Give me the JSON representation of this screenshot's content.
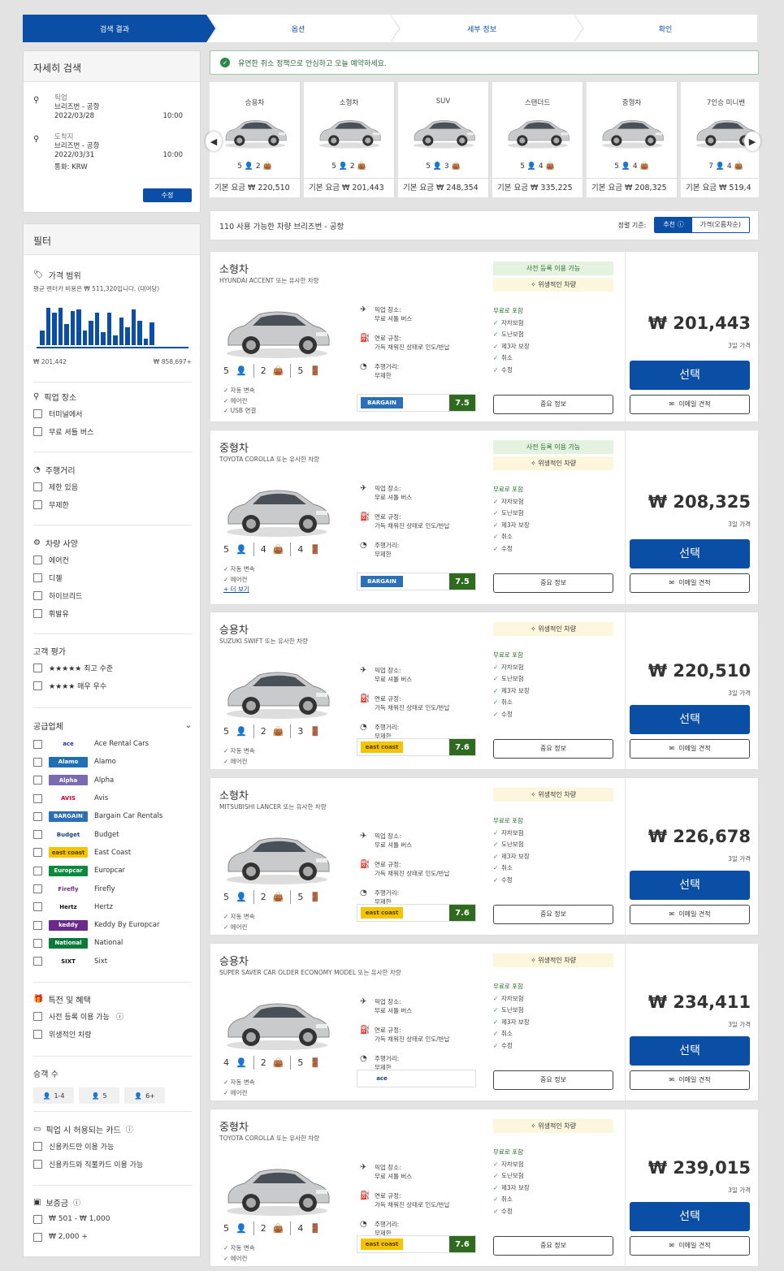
{
  "steps": [
    "검색 결과",
    "옵션",
    "세부 정보",
    "확인"
  ],
  "search": {
    "title": "자세히 검색",
    "pickup_label": "픽업",
    "pickup_place": "브리즈번 - 공항",
    "pickup_date": "2022/03/28",
    "pickup_time": "10:00",
    "drop_label": "도착지",
    "drop_place": "브리즈번 - 공항",
    "drop_date": "2022/03/31",
    "drop_time": "10:00",
    "currency": "통화: KRW",
    "edit": "수정"
  },
  "notice": "유연한 취소 정책으로 안심하고 오늘 예약하세요.",
  "categories": [
    {
      "name": "승용차",
      "spec": "5 👤 2 👜",
      "price": "기본 요금 ₩ 220,510"
    },
    {
      "name": "소형차",
      "spec": "5 👤 2 👜",
      "price": "기본 요금 ₩ 201,443"
    },
    {
      "name": "SUV",
      "spec": "5 👤 3 👜",
      "price": "기본 요금 ₩ 248,354"
    },
    {
      "name": "스탠더드",
      "spec": "5 👤 4 👜",
      "price": "기본 요금 ₩ 335,225"
    },
    {
      "name": "중형차",
      "spec": "5 👤 4 👜",
      "price": "기본 요금 ₩ 208,325"
    },
    {
      "name": "7인승 미니밴",
      "spec": "7 👤 4 👜",
      "price": "기본 요금 ₩ 519,4"
    }
  ],
  "results": {
    "text": "110 사용 가능한 차량 브리즈번 - 공항",
    "sort_label": "정렬 기준:",
    "sort_rec": "추천",
    "sort_price": "가격(오름차순)"
  },
  "filters": {
    "title": "필터",
    "price_title": "가격 범위",
    "price_avg": "평균 렌터카 비용은 ₩ 511,320입니다. (대여당)",
    "price_min": "₩ 201,442",
    "price_max": "₩ 858,697+",
    "pickup_title": "픽업 장소",
    "pickup_opts": [
      "터미널에서",
      "무료 셔틀 버스"
    ],
    "mileage_title": "주행거리",
    "mileage_opts": [
      "제한 있음",
      "무제한"
    ],
    "spec_title": "차량 사양",
    "spec_opts": [
      "에어컨",
      "디젤",
      "하이브리드",
      "휘발유"
    ],
    "rating_title": "고객 평가",
    "rating_opts": [
      "★★★★★ 최고 수준",
      "★★★★ 매우 우수"
    ],
    "supplier_title": "공급업체",
    "suppliers": [
      {
        "logo": "ace",
        "name": "Ace Rental Cars",
        "bg": "#ffffff",
        "fg": "#1f3c8c"
      },
      {
        "logo": "Alamo",
        "name": "Alamo",
        "bg": "#1f6fb5",
        "fg": "#ffffff"
      },
      {
        "logo": "Alpha",
        "name": "Alpha",
        "bg": "#7a6bb0",
        "fg": "#ffffff"
      },
      {
        "logo": "AVIS",
        "name": "Avis",
        "bg": "#ffffff",
        "fg": "#d4002a"
      },
      {
        "logo": "BARGAIN",
        "name": "Bargain Car Rentals",
        "bg": "#2b6fb8",
        "fg": "#ffffff"
      },
      {
        "logo": "Budget",
        "name": "Budget",
        "bg": "#ffffff",
        "fg": "#1c3f8f"
      },
      {
        "logo": "east coast",
        "name": "East Coast",
        "bg": "#f3c400",
        "fg": "#5a3b00"
      },
      {
        "logo": "Europcar",
        "name": "Europcar",
        "bg": "#0a8a3c",
        "fg": "#ffffff"
      },
      {
        "logo": "Firefly",
        "name": "Firefly",
        "bg": "#ffffff",
        "fg": "#7a2a8a"
      },
      {
        "logo": "Hertz",
        "name": "Hertz",
        "bg": "#ffffff",
        "fg": "#111111"
      },
      {
        "logo": "keddy",
        "name": "Keddy By Europcar",
        "bg": "#6a2a8c",
        "fg": "#ffffff"
      },
      {
        "logo": "National",
        "name": "National",
        "bg": "#0a7a3a",
        "fg": "#ffffff"
      },
      {
        "logo": "SIXT",
        "name": "Sixt",
        "bg": "#ffffff",
        "fg": "#111111"
      }
    ],
    "deals_title": "특전 및 혜택",
    "deals_opts": [
      "사전 등록 이용 가능",
      "위생적인 차량"
    ],
    "pax_title": "승객 수",
    "pax_opts": [
      "1-4",
      "5",
      "6+"
    ],
    "card_title": "픽업 시 허용되는 카드",
    "card_opts": [
      "신용카드만 이용 가능",
      "신용카드와 직불카드 이용 가능"
    ],
    "deposit_title": "보증금",
    "deposit_opts": [
      "₩ 501 - ₩ 1,000",
      "₩ 2,000 +"
    ]
  },
  "labels": {
    "pickup": "픽업 장소:",
    "pickup_val": "무료 셔틀 버스",
    "fuel": "연료 규정:",
    "fuel_val": "가득 채워진 상태로 인도/반납",
    "mileage": "주행거리:",
    "mileage_val": "무제한",
    "included": "무료로 포함",
    "inc_items": [
      "자차보험",
      "도난보험",
      "제3자 보장",
      "취소",
      "수정"
    ],
    "important": "중요 정보",
    "select": "선택",
    "email": "이메일 견적",
    "days": "3일 가격",
    "prereg": "사전 등록 이용 가능",
    "hygiene": "위생적인 차량",
    "more": "+ 더 보기"
  },
  "cars": [
    {
      "cls": "소형차",
      "model": "HYUNDAI ACCENT 또는 유사한 차량",
      "pax": "5",
      "bags": "2",
      "doors": "5",
      "feats": [
        "자동 변속",
        "에어컨",
        "USB 연결"
      ],
      "vendor": "BARGAIN",
      "score": "7.5",
      "price": "₩ 201,443",
      "prereg": true
    },
    {
      "cls": "중형차",
      "model": "TOYOTA COROLLA 또는 유사한 차량",
      "pax": "5",
      "bags": "4",
      "doors": "4",
      "feats": [
        "자동 변속",
        "에어컨"
      ],
      "vendor": "BARGAIN",
      "score": "7.5",
      "price": "₩ 208,325",
      "prereg": true,
      "more": true
    },
    {
      "cls": "승용차",
      "model": "SUZUKI SWIFT 또는 유사한 차량",
      "pax": "5",
      "bags": "2",
      "doors": "3",
      "feats": [
        "자동 변속",
        "에어컨"
      ],
      "vendor": "east coast",
      "score": "7.6",
      "price": "₩ 220,510",
      "prereg": false
    },
    {
      "cls": "소형차",
      "model": "MITSUBISHI LANCER 또는 유사한 차량",
      "pax": "5",
      "bags": "2",
      "doors": "5",
      "feats": [
        "자동 변속",
        "에어컨"
      ],
      "vendor": "east coast",
      "score": "7.6",
      "price": "₩ 226,678",
      "prereg": false
    },
    {
      "cls": "승용차",
      "model": "SUPER SAVER CAR OLDER ECONOMY MODEL 또는 유사한 차량",
      "pax": "4",
      "bags": "2",
      "doors": "5",
      "feats": [
        "자동 변속",
        "에어컨"
      ],
      "vendor": "ace",
      "score": "",
      "price": "₩ 234,411",
      "prereg": false
    },
    {
      "cls": "중형차",
      "model": "TOYOTA COROLLA 또는 유사한 차량",
      "pax": "5",
      "bags": "2",
      "doors": "4",
      "feats": [
        "자동 변속",
        "에어컨"
      ],
      "vendor": "east coast",
      "score": "7.6",
      "price": "₩ 239,015",
      "prereg": false
    }
  ]
}
